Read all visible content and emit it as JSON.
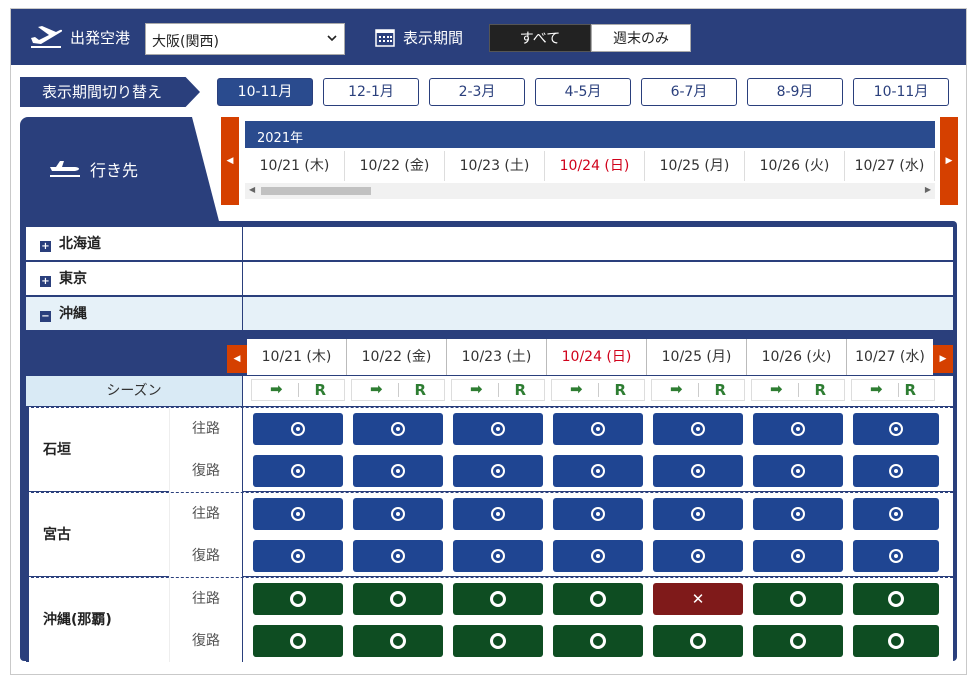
{
  "header": {
    "departure_label": "出発空港",
    "departure_value": "大阪(関西)",
    "period_label": "表示期間",
    "filter_all": "すべて",
    "filter_weekend": "週末のみ"
  },
  "period_switch": {
    "label": "表示期間切り替え",
    "tabs": [
      "10-11月",
      "12-1月",
      "2-3月",
      "4-5月",
      "6-7月",
      "8-9月",
      "10-11月"
    ],
    "active_index": 0
  },
  "destination": {
    "label": "行き先",
    "year": "2021年",
    "dates": [
      "10/21 (木)",
      "10/22 (金)",
      "10/23 (土)",
      "10/24 (日)",
      "10/25 (月)",
      "10/26 (火)",
      "10/27 (水)"
    ],
    "holiday_index": 3
  },
  "regions": [
    {
      "name": "北海道",
      "toggle": "+",
      "open": false
    },
    {
      "name": "東京",
      "toggle": "+",
      "open": false
    },
    {
      "name": "沖縄",
      "toggle": "−",
      "open": true
    }
  ],
  "inner_dates": [
    "10/21 (木)",
    "10/22 (金)",
    "10/23 (土)",
    "10/24 (日)",
    "10/25 (月)",
    "10/26 (火)",
    "10/27 (水)"
  ],
  "season": {
    "label": "シーズン",
    "outbound_symbol": "➡",
    "return_symbol": "R"
  },
  "legs": {
    "outbound": "往路",
    "return": "復路"
  },
  "areas": [
    {
      "name": "石垣",
      "color": "blue",
      "outbound": [
        "dot",
        "dot",
        "dot",
        "dot",
        "dot",
        "dot",
        "dot"
      ],
      "return": [
        "dot",
        "dot",
        "dot",
        "dot",
        "dot",
        "dot",
        "dot"
      ]
    },
    {
      "name": "宮古",
      "color": "blue",
      "outbound": [
        "dot",
        "dot",
        "dot",
        "dot",
        "dot",
        "dot",
        "dot"
      ],
      "return": [
        "dot",
        "dot",
        "dot",
        "dot",
        "dot",
        "dot",
        "dot"
      ]
    },
    {
      "name": "沖縄(那覇)",
      "color": "green",
      "outbound": [
        "ring",
        "ring",
        "ring",
        "ring",
        "cross",
        "ring",
        "ring"
      ],
      "return": [
        "ring",
        "ring",
        "ring",
        "ring",
        "ring",
        "ring",
        "ring"
      ]
    }
  ],
  "symbols": {
    "cross": "✕"
  },
  "colors": {
    "navy": "#2a3f7c",
    "accent": "#d54000",
    "holiday": "#d0021b",
    "available_blue": "#1f4592",
    "available_green": "#0e4d22",
    "unavailable": "#7f1a1a"
  }
}
